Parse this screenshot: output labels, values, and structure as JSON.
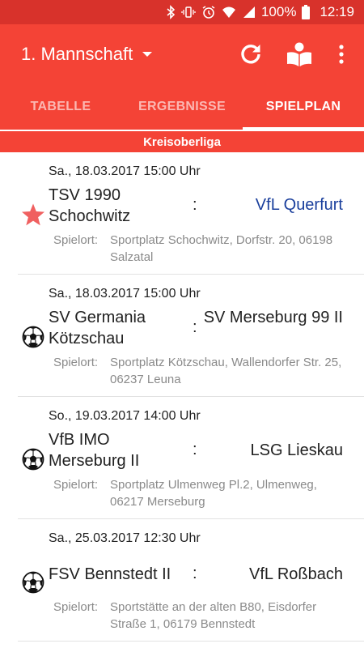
{
  "statusbar": {
    "battery_text": "100%",
    "time": "12:19"
  },
  "appbar": {
    "team_selector": "1. Mannschaft"
  },
  "tabs": [
    {
      "label": "TABELLE",
      "active": false
    },
    {
      "label": "ERGEBNISSE",
      "active": false
    },
    {
      "label": "SPIELPLAN",
      "active": true
    }
  ],
  "league": "Kreisoberliga",
  "matches": [
    {
      "datetime": "Sa., 18.03.2017 15:00 Uhr",
      "home": "TSV 1990 Schochwitz",
      "separator": ":",
      "away": "VfL Querfurt",
      "away_highlight": true,
      "icon": "star-icon",
      "venue_label": "Spielort:",
      "venue": "Sportplatz Schochwitz, Dorfstr. 20, 06198 Salzatal"
    },
    {
      "datetime": "Sa., 18.03.2017 15:00 Uhr",
      "home": "SV Germania Kötzschau",
      "separator": ":",
      "away": "SV Merseburg 99 II",
      "away_highlight": false,
      "icon": "soccer-ball-icon",
      "venue_label": "Spielort:",
      "venue": "Sportplatz Kötzschau, Wallendorfer Str. 25, 06237 Leuna"
    },
    {
      "datetime": "So., 19.03.2017 14:00 Uhr",
      "home": "VfB IMO Merseburg II",
      "separator": ":",
      "away": "LSG Lieskau",
      "away_highlight": false,
      "icon": "soccer-ball-icon",
      "venue_label": "Spielort:",
      "venue": "Sportplatz Ulmenweg Pl.2, Ulmenweg, 06217 Merseburg"
    },
    {
      "datetime": "Sa., 25.03.2017 12:30 Uhr",
      "home": "FSV Bennstedt II",
      "separator": ":",
      "away": "VfL Roßbach",
      "away_highlight": false,
      "icon": "soccer-ball-icon",
      "venue_label": "Spielort:",
      "venue": "Sportstätte an der alten B80, Eisdorfer Straße 1, 06179 Bennstedt"
    }
  ],
  "colors": {
    "primary": "#f44336",
    "status_bar": "#d8322b",
    "favorite_team": "#1a3f9c",
    "star": "#f06060"
  }
}
